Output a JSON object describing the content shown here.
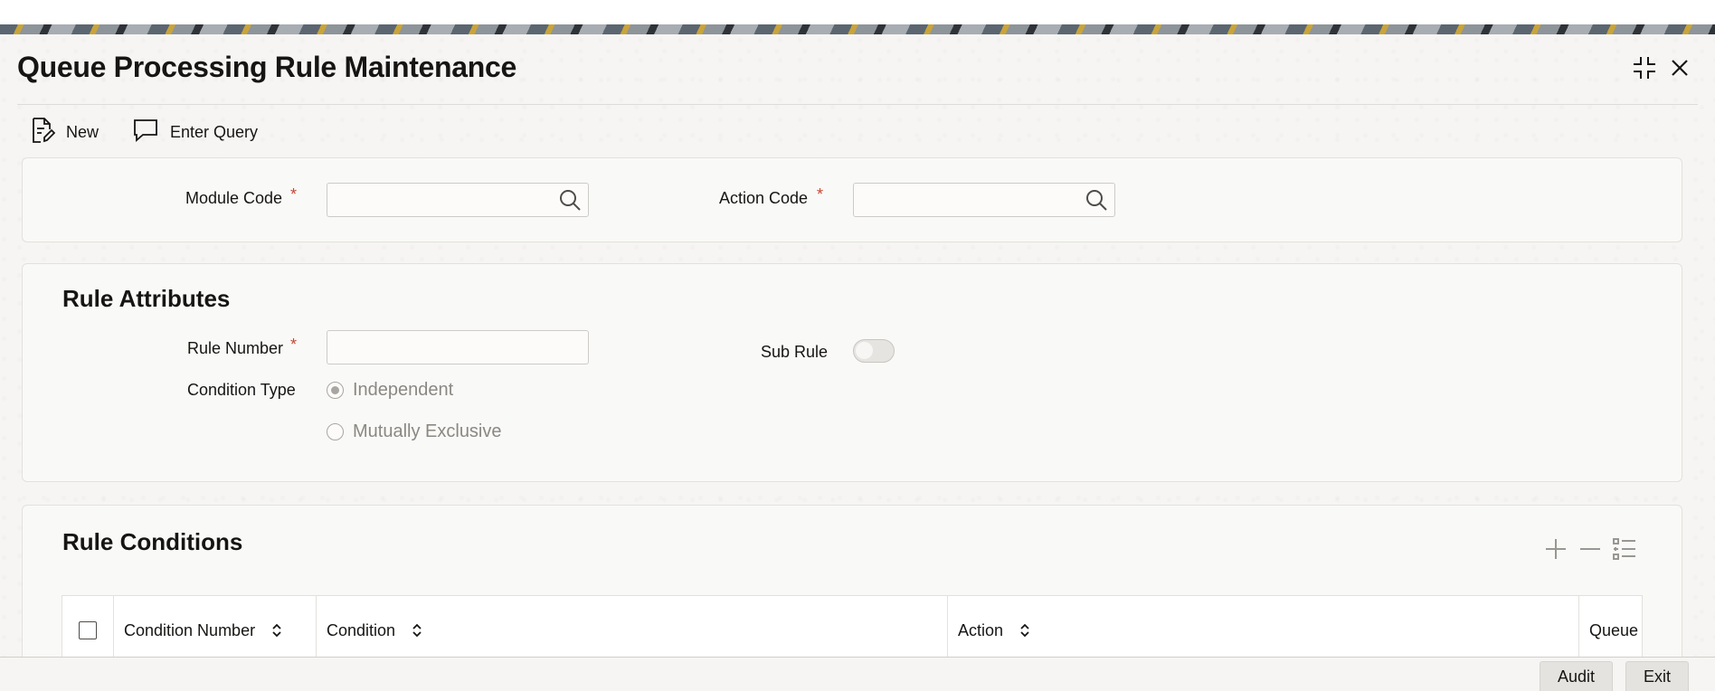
{
  "window": {
    "title": "Queue Processing Rule Maintenance",
    "icons": {
      "collapse": "collapse-icon",
      "close": "close-icon"
    }
  },
  "toolbar": {
    "new_label": "New",
    "enter_query_label": "Enter Query",
    "icons": {
      "new": "new-document-icon",
      "enter_query": "chat-bubble-icon"
    }
  },
  "header_fields": {
    "module_code": {
      "label": "Module Code",
      "required_mark": "*",
      "value": ""
    },
    "action_code": {
      "label": "Action Code",
      "required_mark": "*",
      "value": ""
    }
  },
  "rule_attributes": {
    "title": "Rule Attributes",
    "rule_number": {
      "label": "Rule Number",
      "required_mark": "*",
      "value": ""
    },
    "condition_type": {
      "label": "Condition Type",
      "options": [
        "Independent",
        "Mutually Exclusive"
      ],
      "selected": "Independent"
    },
    "sub_rule": {
      "label": "Sub Rule",
      "on": false
    }
  },
  "rule_conditions": {
    "title": "Rule Conditions",
    "tools": [
      "add-row-icon",
      "remove-row-icon",
      "single-view-icon"
    ],
    "columns": [
      "Condition Number",
      "Condition",
      "Action",
      "Queue"
    ]
  },
  "footer": {
    "audit_label": "Audit",
    "exit_label": "Exit"
  },
  "colors": {
    "required": "#c74634",
    "text": "#161513",
    "disabled_text": "#8b8883",
    "panel_border": "#e3e1dd"
  }
}
